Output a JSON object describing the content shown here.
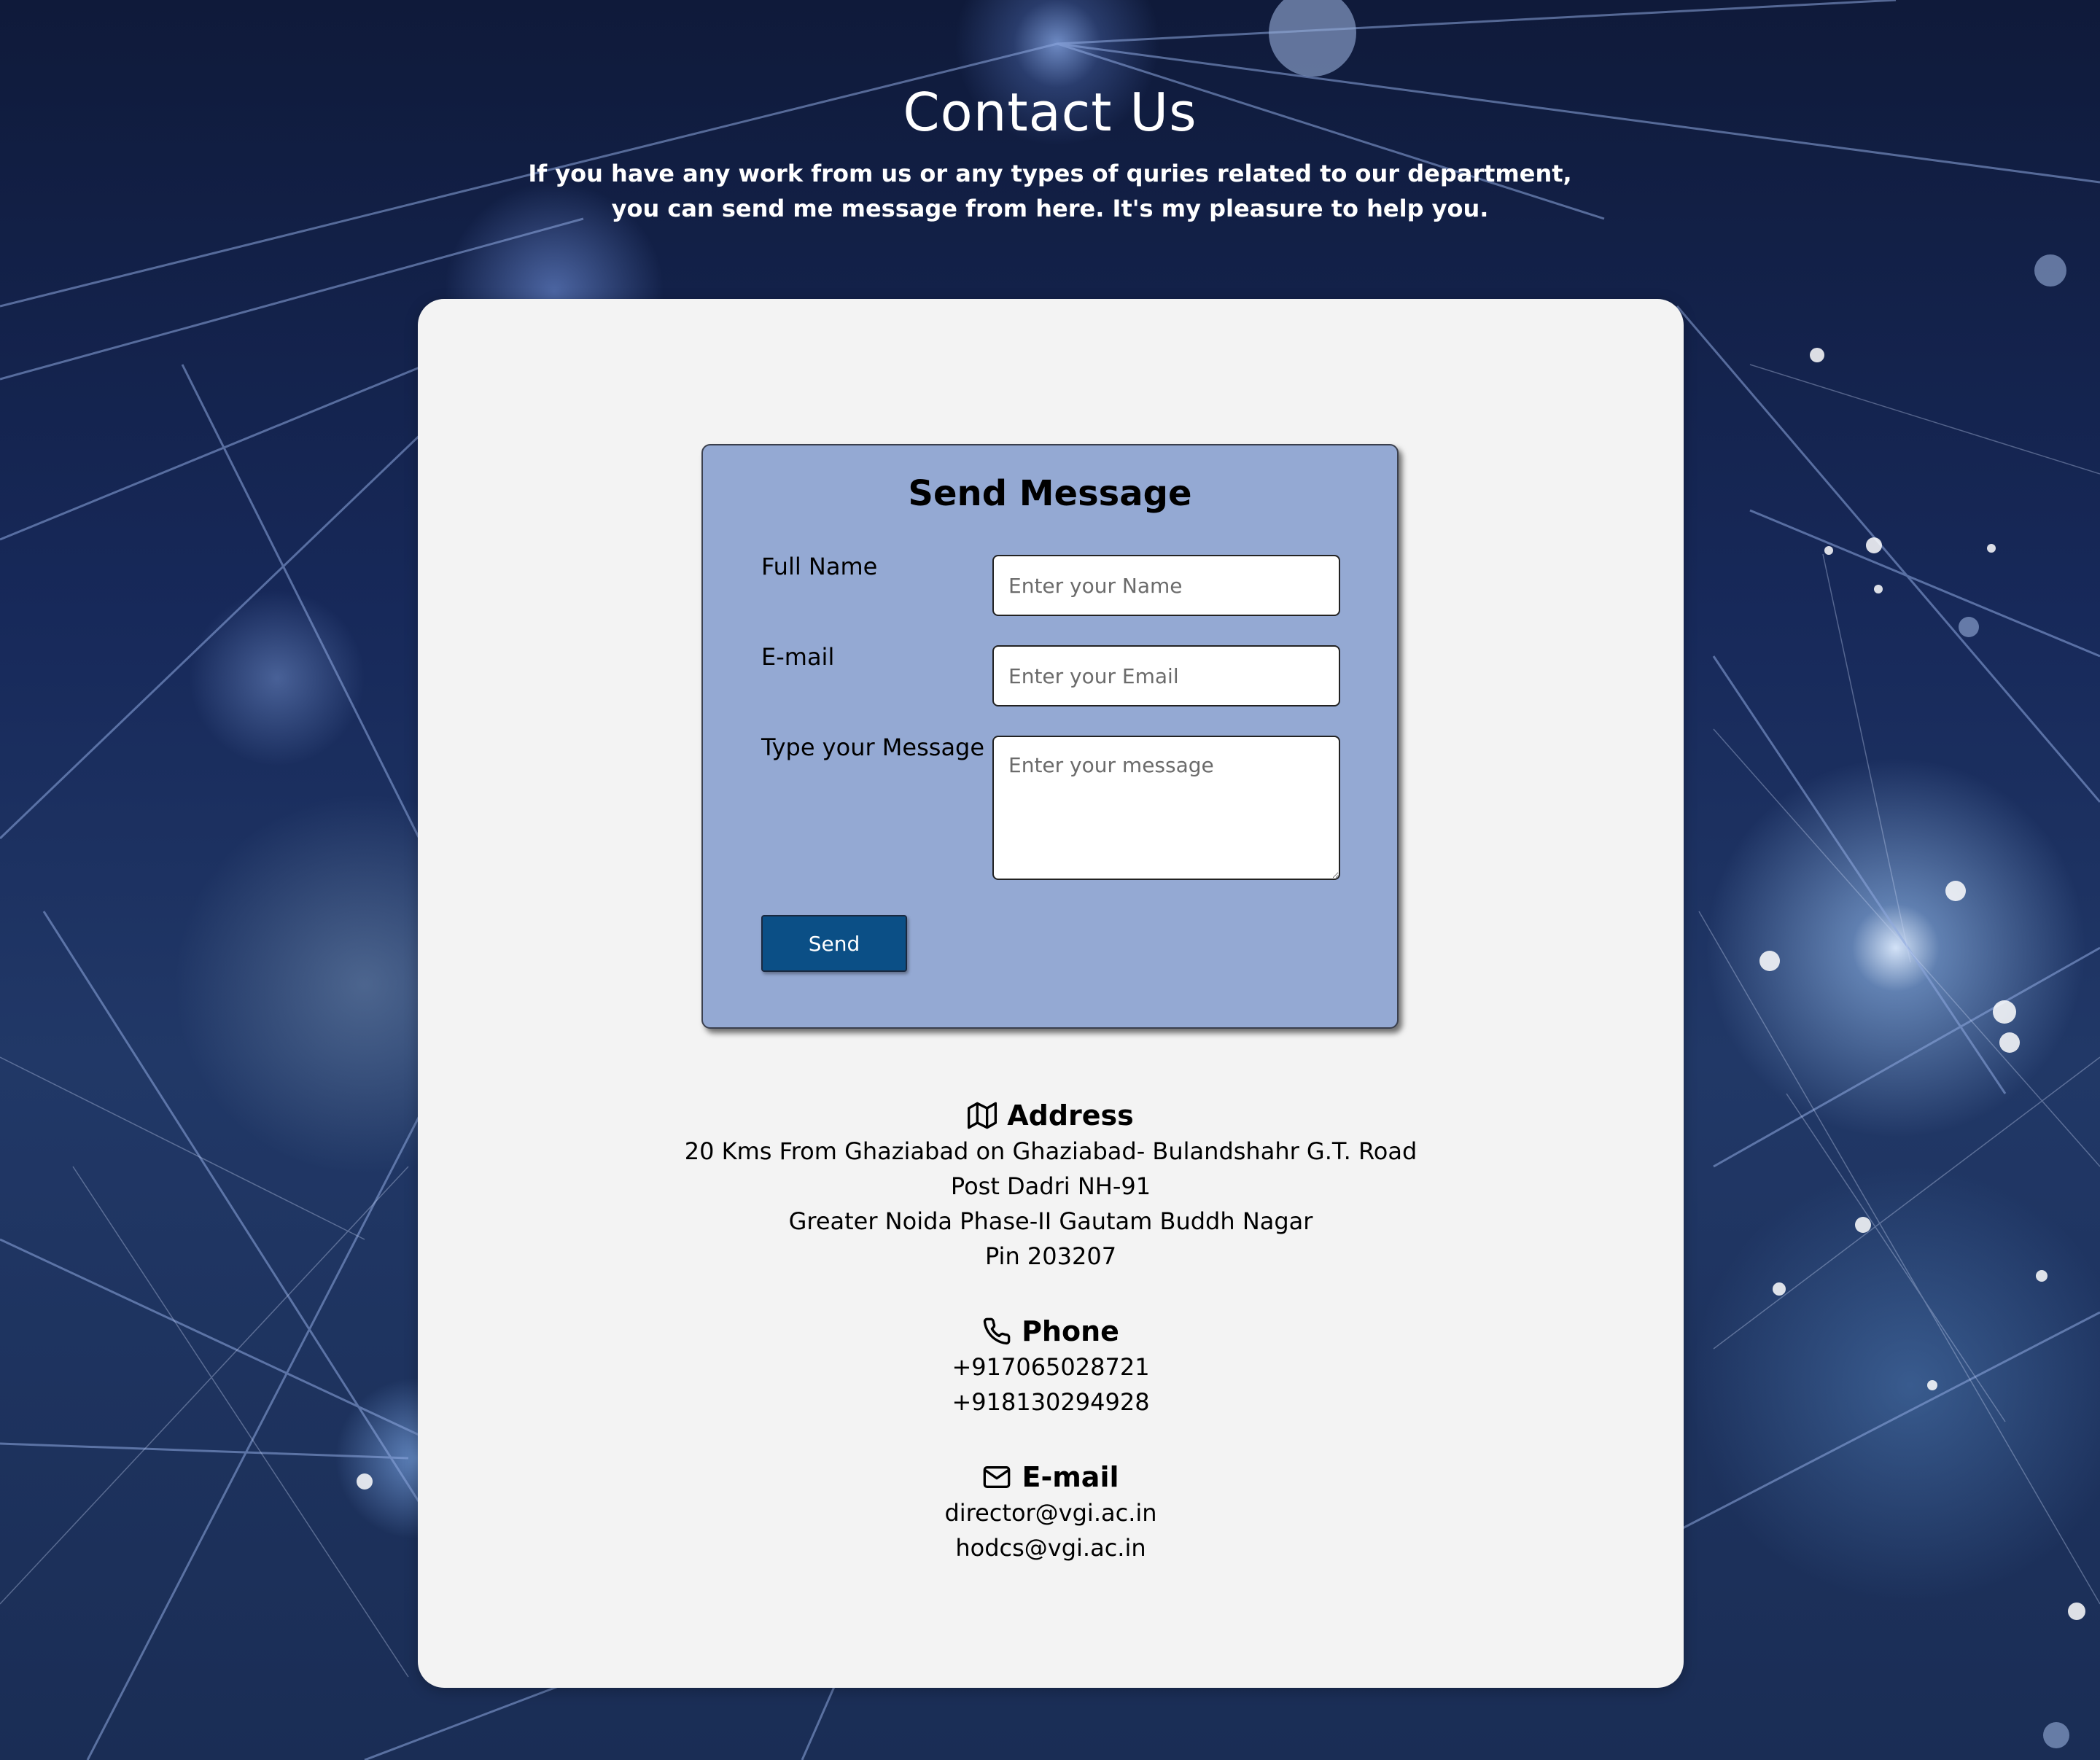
{
  "header": {
    "title": "Contact Us",
    "subtitle": "If you have any work from us or any types of quries related to our department, you can send me message from here. It's my pleasure to help you."
  },
  "form": {
    "title": "Send Message",
    "name_label": "Full Name",
    "name_placeholder": "Enter your Name",
    "email_label": "E-mail",
    "email_placeholder": "Enter your Email",
    "message_label": "Type your Message",
    "message_placeholder": "Enter your message",
    "send_label": "Send"
  },
  "address": {
    "icon": "map-icon",
    "heading": "Address",
    "lines": [
      "20 Kms From Ghaziabad on Ghaziabad- Bulandshahr G.T. Road",
      "Post Dadri NH-91",
      "Greater Noida Phase-II Gautam Buddh Nagar",
      "Pin 203207"
    ]
  },
  "phone": {
    "icon": "phone-icon",
    "heading": "Phone",
    "lines": [
      "+917065028721",
      "+918130294928"
    ]
  },
  "email": {
    "icon": "mail-icon",
    "heading": "E-mail",
    "lines": [
      "director@vgi.ac.in",
      "hodcs@vgi.ac.in"
    ]
  },
  "colors": {
    "card_bg": "#f3f3f3",
    "form_bg": "#94a9d3",
    "button_bg": "#0b4f86",
    "background": "#17295a"
  }
}
